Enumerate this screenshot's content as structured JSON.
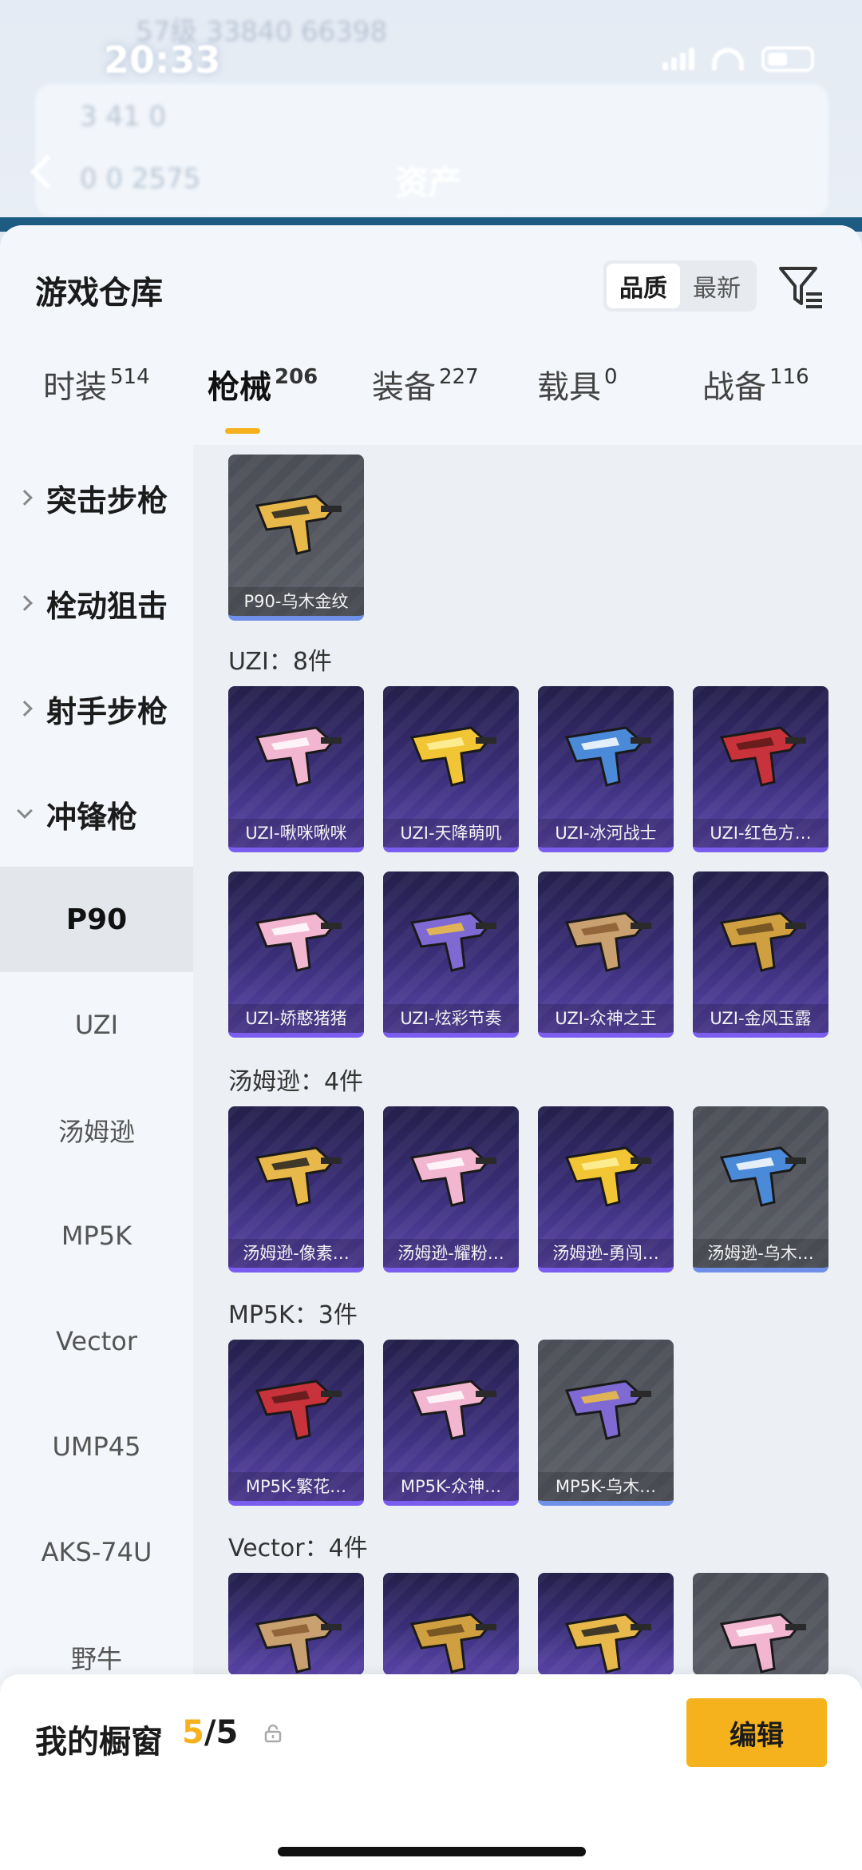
{
  "background": {
    "status_time": "20:33",
    "blur_line1": "57级  33840  66398",
    "blur_line2": "3  41  0",
    "blur_line3": "0  0  2575",
    "title": "资产"
  },
  "header": {
    "title": "游戏仓库",
    "sort_options": [
      "品质",
      "最新"
    ],
    "active_sort": "品质"
  },
  "tabs": [
    {
      "label": "时装",
      "count": "514"
    },
    {
      "label": "枪械",
      "count": "206"
    },
    {
      "label": "装备",
      "count": "227"
    },
    {
      "label": "载具",
      "count": "0"
    },
    {
      "label": "战备",
      "count": "116"
    }
  ],
  "active_tab": "枪械",
  "sidebar": {
    "categories": [
      "突击步枪",
      "栓动狙击",
      "射手步枪",
      "冲锋枪"
    ],
    "subcategories": [
      "P90",
      "UZI",
      "汤姆逊",
      "MP5K",
      "Vector",
      "UMP45",
      "AKS-74U",
      "野牛"
    ],
    "active_sub": "P90"
  },
  "groups": [
    {
      "label": "",
      "items": [
        {
          "name": "P90-乌木金纹",
          "style": "gray"
        }
      ]
    },
    {
      "label": "UZI：8件",
      "items": [
        {
          "name": "UZI-啾咪啾咪",
          "style": "purple"
        },
        {
          "name": "UZI-天降萌叽",
          "style": "purple"
        },
        {
          "name": "UZI-冰河战士",
          "style": "purple"
        },
        {
          "name": "UZI-红色方…",
          "style": "purple"
        },
        {
          "name": "UZI-娇憨猪猪",
          "style": "purple"
        },
        {
          "name": "UZI-炫彩节奏",
          "style": "purple"
        },
        {
          "name": "UZI-众神之王",
          "style": "purple"
        },
        {
          "name": "UZI-金风玉露",
          "style": "purple"
        }
      ]
    },
    {
      "label": "汤姆逊：4件",
      "items": [
        {
          "name": "汤姆逊-像素…",
          "style": "purple"
        },
        {
          "name": "汤姆逊-耀粉…",
          "style": "purple"
        },
        {
          "name": "汤姆逊-勇闯…",
          "style": "purple"
        },
        {
          "name": "汤姆逊-乌木…",
          "style": "gray"
        }
      ]
    },
    {
      "label": "MP5K：3件",
      "items": [
        {
          "name": "MP5K-繁花…",
          "style": "purple"
        },
        {
          "name": "MP5K-众神…",
          "style": "purple"
        },
        {
          "name": "MP5K-乌木…",
          "style": "gray"
        }
      ]
    },
    {
      "label": "Vector：4件",
      "items": [
        {
          "name": "",
          "style": "purple"
        },
        {
          "name": "",
          "style": "purple"
        },
        {
          "name": "",
          "style": "purple"
        },
        {
          "name": "",
          "style": "gray"
        }
      ]
    }
  ],
  "bottom_bar": {
    "label": "我的橱窗",
    "count_current": "5",
    "count_total": "/5",
    "edit_label": "编辑"
  },
  "icons": {
    "filter": "filter-icon",
    "share": "share-icon",
    "lock": "lock-icon",
    "back": "back-arrow-icon"
  },
  "colors": {
    "accent": "#f6b21c",
    "card_purple": "#3b2f7a",
    "card_gray": "#55585f"
  }
}
